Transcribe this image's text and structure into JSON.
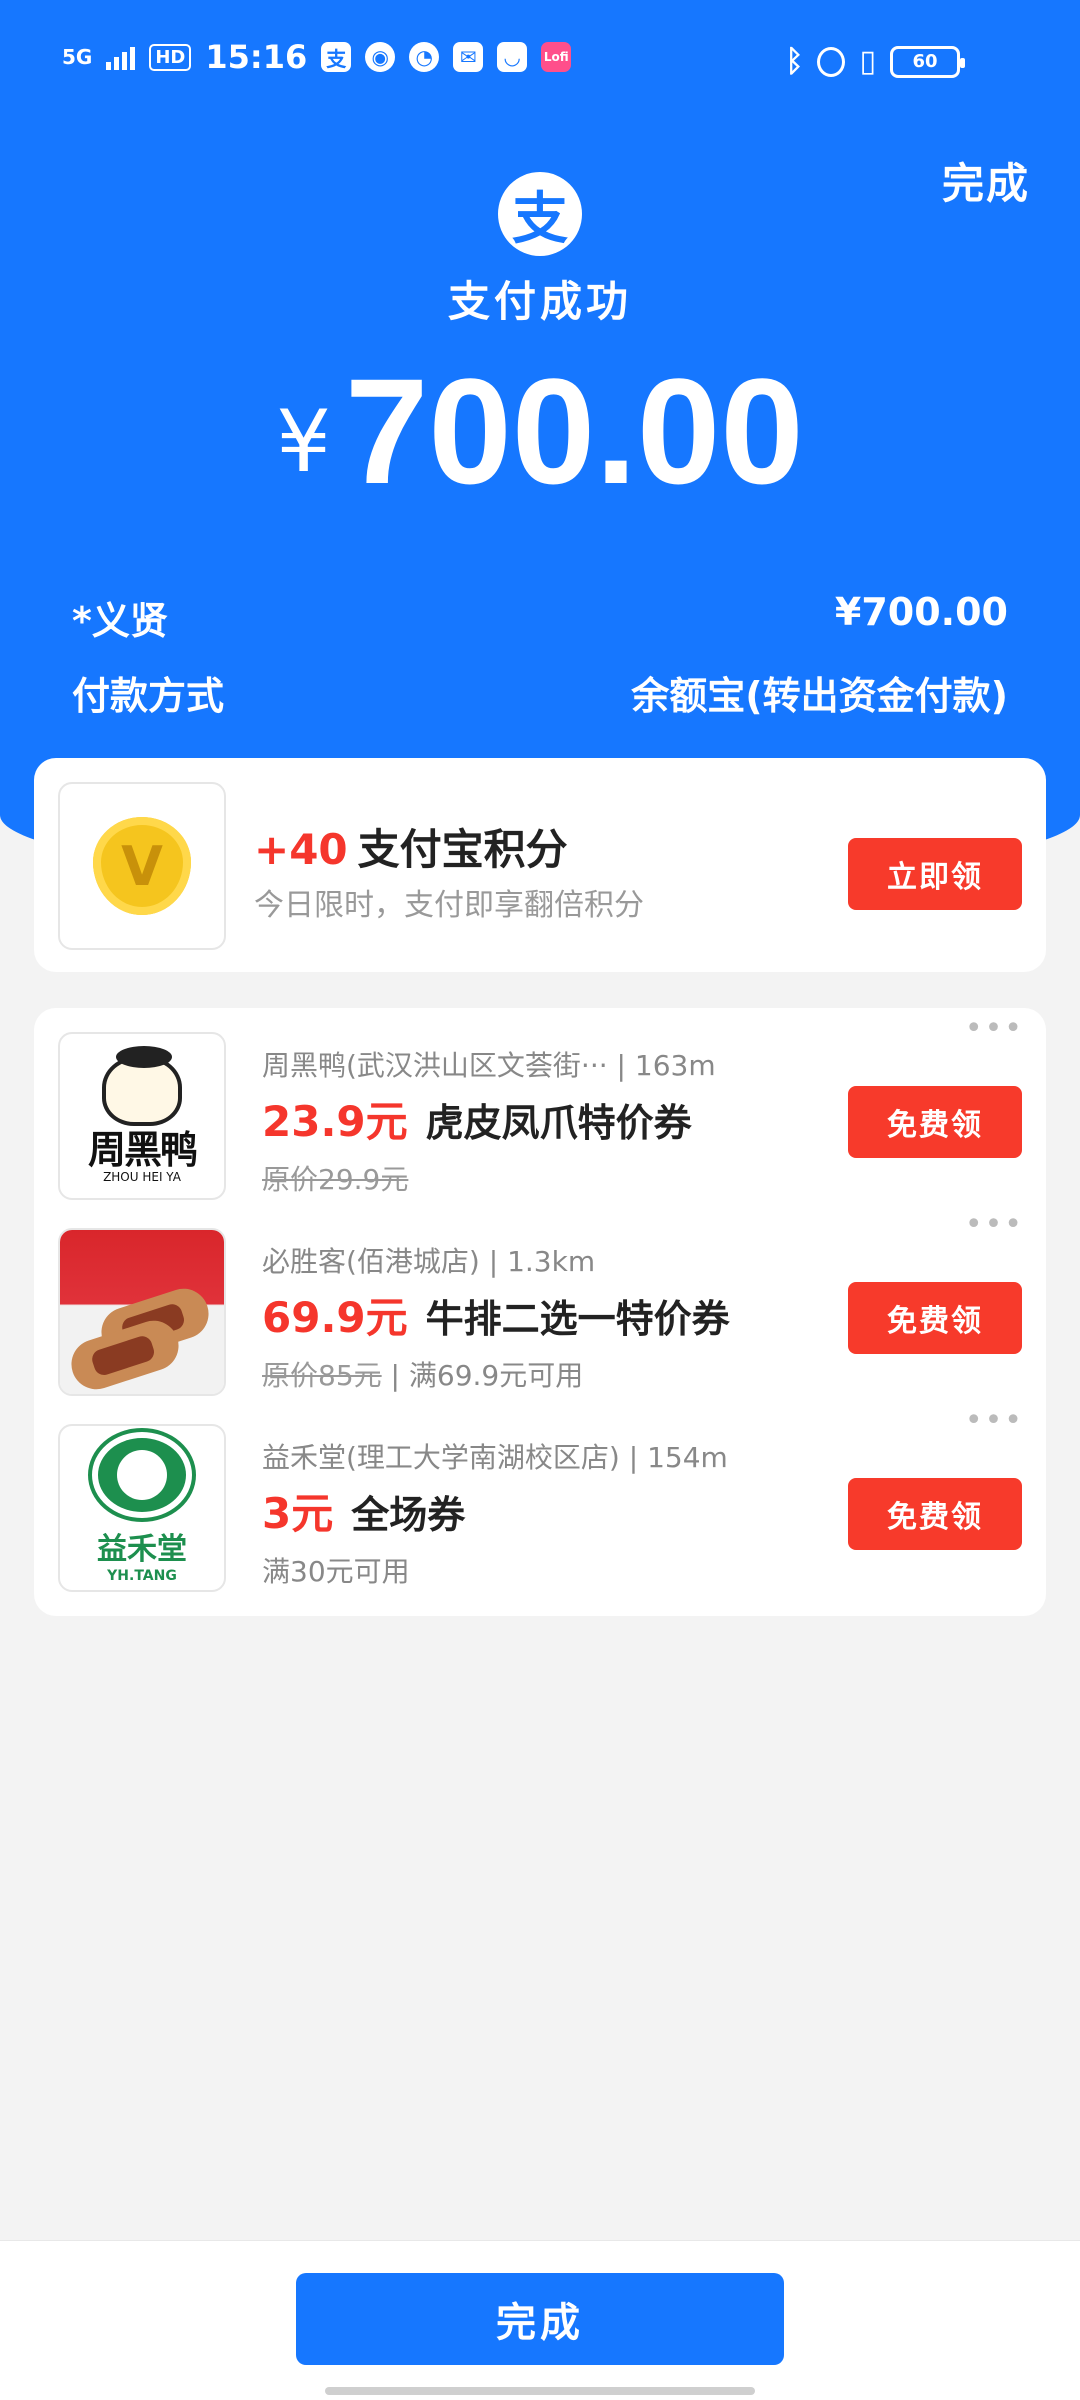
{
  "status_bar": {
    "network": "5G",
    "hd": "HD",
    "time": "15:16",
    "battery": "60",
    "app_icons": [
      "alipay-icon",
      "weibo-icon",
      "speed-icon",
      "message-icon",
      "shield-icon",
      "pink-app-icon"
    ]
  },
  "header": {
    "done_label": "完成",
    "logo_char": "支",
    "title": "支付成功",
    "currency": "¥",
    "amount": "700.00"
  },
  "details": {
    "payee_label": "*义贤",
    "payee_value": "¥700.00",
    "method_label": "付款方式",
    "method_value": "余额宝(转出资金付款)"
  },
  "points_card": {
    "points": "+40",
    "title": "支付宝积分",
    "subtitle": "今日限时，支付即享翻倍积分",
    "button": "立即领",
    "icon_letter": "V"
  },
  "deals": [
    {
      "shop": "周黑鸭(武汉洪山区文荟街···",
      "distance": "163m",
      "price": "23.9元",
      "title": "虎皮凤爪特价券",
      "original": "原价29.9元",
      "condition": "",
      "button": "免费领",
      "thumb": {
        "name": "周黑鸭",
        "en": "ZHOU HEI YA"
      }
    },
    {
      "shop": "必胜客(佰港城店)",
      "distance": "1.3km",
      "price": "69.9元",
      "title": "牛排二选一特价券",
      "original": "原价85元",
      "condition": "满69.9元可用",
      "button": "免费领"
    },
    {
      "shop": "益禾堂(理工大学南湖校区店)",
      "distance": "154m",
      "price": "3元",
      "title": "全场券",
      "original": "",
      "condition": "满30元可用",
      "button": "免费领",
      "thumb": {
        "name": "益禾堂",
        "en": "YH.TANG"
      }
    }
  ],
  "more_icon": "•••",
  "bottom": {
    "done_label": "完成"
  },
  "colors": {
    "brand_blue": "#1677ff",
    "accent_red": "#f5362c"
  }
}
